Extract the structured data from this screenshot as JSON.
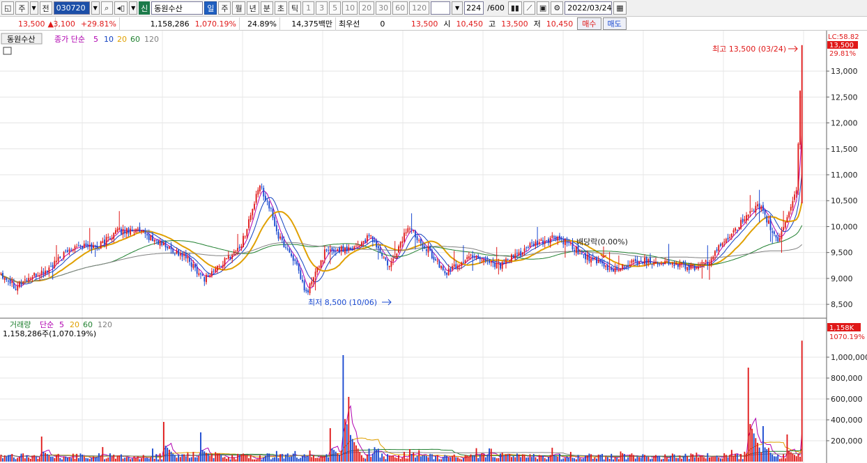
{
  "toolbar": {
    "market": "주",
    "prefix": "전",
    "code": "030720",
    "name_badge": "신",
    "stock_name": "동원수산",
    "periods": [
      "일",
      "주",
      "월",
      "년",
      "분",
      "초",
      "틱"
    ],
    "active_period": "일",
    "intervals": [
      "1",
      "3",
      "5",
      "10",
      "20",
      "30",
      "60",
      "120"
    ],
    "count": "224",
    "count_total": "/600",
    "date": "2022/03/24"
  },
  "infobar": {
    "price": "13,500",
    "change": "3,100",
    "change_pct": "+29.81%",
    "volume": "1,158,286",
    "volume_ratio": "1,070.19%",
    "turnover": "24.89%",
    "amount": "14,375백만",
    "priority_label": "최우선",
    "priority_val": "0",
    "ask": "13,500",
    "open_label": "시",
    "open": "10,450",
    "high_label": "고",
    "high": "13,500",
    "low_label": "저",
    "low": "10,450",
    "buy": "매수",
    "sell": "매도"
  },
  "colors": {
    "up": "#e01818",
    "down": "#1848d0",
    "ma5": "#b000b0",
    "ma10": "#1040c0",
    "ma20": "#e0a000",
    "ma60": "#208030",
    "ma120": "#808080"
  },
  "chart_data": [
    {
      "type": "candlestick",
      "legend": {
        "name": "동원수산",
        "ind": "종가 단순",
        "ma": [
          "5",
          "10",
          "20",
          "60",
          "120"
        ]
      },
      "ylim": [
        8300,
        13700
      ],
      "yticks": [
        8500,
        9000,
        9500,
        10000,
        10500,
        11000,
        11500,
        12000,
        12500,
        13000
      ],
      "ytick_labels": [
        "8,500",
        "9,000",
        "9,500",
        "10,000",
        "10,500",
        "11,000",
        "11,500",
        "12,000",
        "12,500",
        "13,000"
      ],
      "right_tag": {
        "top": "LC:58.82",
        "price": "13,500",
        "pct": "29.81%"
      },
      "annotations": {
        "high": "최고 13,500 (03/24)",
        "low": "최저 8,500 (10/06)",
        "dividend": "배당락(0.00%)"
      },
      "anchors": [
        [
          0,
          9100
        ],
        [
          8,
          8850
        ],
        [
          15,
          9000
        ],
        [
          25,
          9150
        ],
        [
          40,
          9650
        ],
        [
          52,
          9600
        ],
        [
          62,
          9900
        ],
        [
          72,
          9950
        ],
        [
          85,
          9700
        ],
        [
          100,
          9400
        ],
        [
          110,
          9000
        ],
        [
          120,
          9300
        ],
        [
          130,
          9650
        ],
        [
          140,
          10800
        ],
        [
          145,
          10400
        ],
        [
          150,
          9800
        ],
        [
          158,
          9400
        ],
        [
          165,
          8700
        ],
        [
          175,
          9500
        ],
        [
          190,
          9600
        ],
        [
          200,
          9800
        ],
        [
          210,
          9200
        ],
        [
          220,
          10000
        ],
        [
          230,
          9600
        ],
        [
          240,
          9100
        ],
        [
          255,
          9450
        ],
        [
          270,
          9250
        ],
        [
          285,
          9600
        ],
        [
          300,
          9800
        ],
        [
          315,
          9450
        ],
        [
          330,
          9150
        ],
        [
          345,
          9350
        ],
        [
          360,
          9300
        ],
        [
          375,
          9200
        ],
        [
          382,
          9300
        ],
        [
          395,
          9900
        ],
        [
          410,
          10400
        ],
        [
          420,
          9700
        ],
        [
          430,
          10700
        ],
        [
          433,
          13500
        ]
      ],
      "n_candles": 434
    },
    {
      "type": "bar",
      "legend": {
        "name": "거래량",
        "ind": "단순",
        "ma": [
          "5",
          "20",
          "60",
          "120"
        ]
      },
      "info": "1,158,286주(1,070.19%)",
      "ylim": [
        0,
        1160000
      ],
      "yticks": [
        200000,
        400000,
        600000,
        800000,
        1000000
      ],
      "ytick_labels": [
        "200,000",
        "400,000",
        "600,000",
        "800,000",
        "1,000,000K"
      ],
      "right_tag": {
        "val": "1,158K",
        "pct": "1070.19%"
      },
      "spikes": [
        [
          22,
          240000
        ],
        [
          88,
          380000
        ],
        [
          108,
          280000
        ],
        [
          178,
          320000
        ],
        [
          185,
          1020000
        ],
        [
          188,
          620000
        ],
        [
          404,
          900000
        ],
        [
          412,
          340000
        ],
        [
          425,
          260000
        ],
        [
          433,
          1158286
        ]
      ]
    }
  ]
}
